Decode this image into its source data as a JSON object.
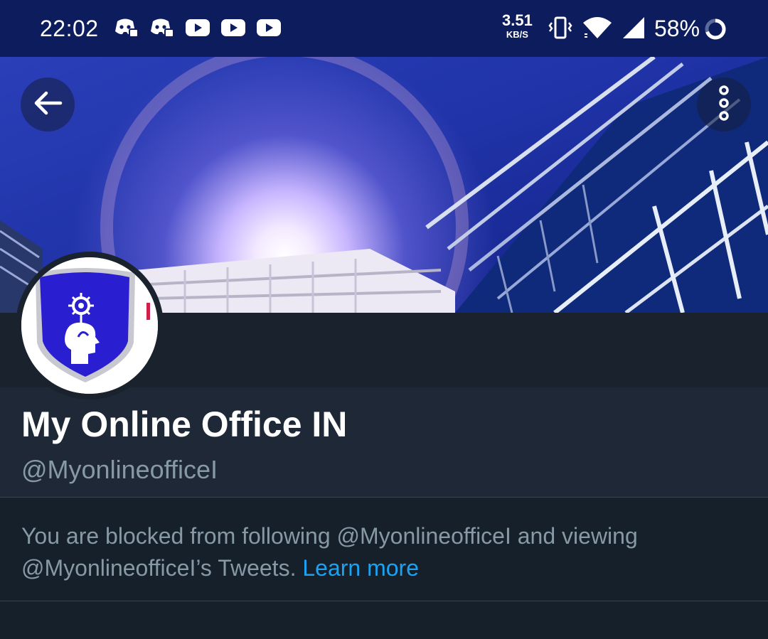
{
  "status_bar": {
    "time": "22:02",
    "network_speed_value": "3.51",
    "network_speed_unit": "KB/S",
    "battery_percent": "58%",
    "notification_icons": [
      "discord-icon",
      "discord-icon",
      "youtube-icon",
      "youtube-icon",
      "youtube-icon"
    ],
    "system_icons": [
      "vibrate-icon",
      "wifi-icon",
      "cell-signal-icon",
      "battery-ring-icon"
    ]
  },
  "header": {
    "back_icon": "arrow-left-icon",
    "more_icon": "more-vertical-icon"
  },
  "profile": {
    "display_name": "My Online Office IN",
    "handle": "@MyonlineofficeI",
    "avatar_icon": "shield-head-flower-logo"
  },
  "blocked_notice": {
    "line1": "You are blocked from following @MyonlineofficeI and viewing",
    "line2_prefix": "@MyonlineofficeI’s Tweets. ",
    "link_label": "Learn more"
  },
  "colors": {
    "status_bar_bg": "#0c1c5c",
    "page_bg": "#15202b",
    "profile_bg": "#1e2836",
    "secondary_text": "#8899a6",
    "link": "#1da1f2",
    "logo_shield": "#2a1fd0"
  }
}
